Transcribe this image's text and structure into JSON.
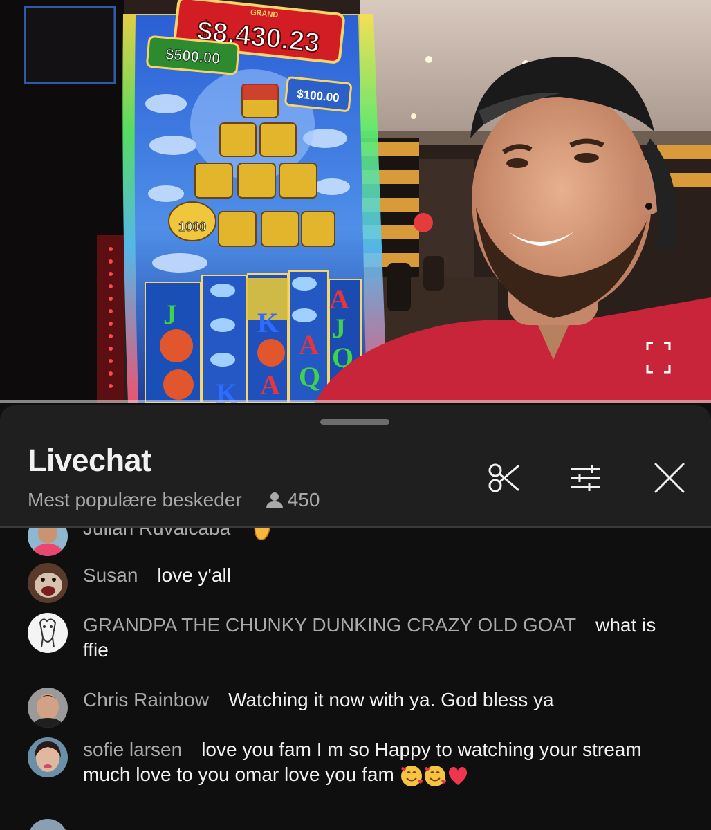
{
  "video": {
    "jackpots": {
      "grand_label": "GRAND",
      "grand_value": "$8,430.23",
      "left_value": "$500.00",
      "right_value": "$100.00",
      "bonus_value": "1000"
    },
    "reel_symbols": [
      "J",
      "K",
      "A",
      "Q",
      "A",
      "J",
      "K",
      "A",
      "Q"
    ],
    "fullscreen_icon": "fullscreen-icon"
  },
  "livechat": {
    "title": "Livechat",
    "mode": "Mest populære beskeder",
    "viewer_count": "450",
    "icons": [
      "scissors-icon",
      "filter-sliders-icon",
      "close-icon"
    ],
    "messages": [
      {
        "author": "Julian Ruvalcaba",
        "text": "",
        "emoji": "waving-hand"
      },
      {
        "author": "Susan",
        "text": "love y'all",
        "emoji": ""
      },
      {
        "author": "GRANDPA THE CHUNKY DUNKING CRAZY OLD GOAT",
        "text": "what is ffie",
        "emoji": ""
      },
      {
        "author": "Chris Rainbow",
        "text": "Watching it now with ya. God bless ya",
        "emoji": ""
      },
      {
        "author": "sofie larsen",
        "text": "love you fam I m so Happy to watching your stream much love to you omar love you fam",
        "emoji": "smiling-hearts smiling-hearts red-heart"
      }
    ]
  },
  "colors": {
    "panel_bg": "#1f1f1f",
    "chat_bg": "#0f0f0f",
    "primary_text": "#f1f1f1",
    "secondary_text": "#aaaaaa",
    "shirt_red": "#c8243a"
  }
}
